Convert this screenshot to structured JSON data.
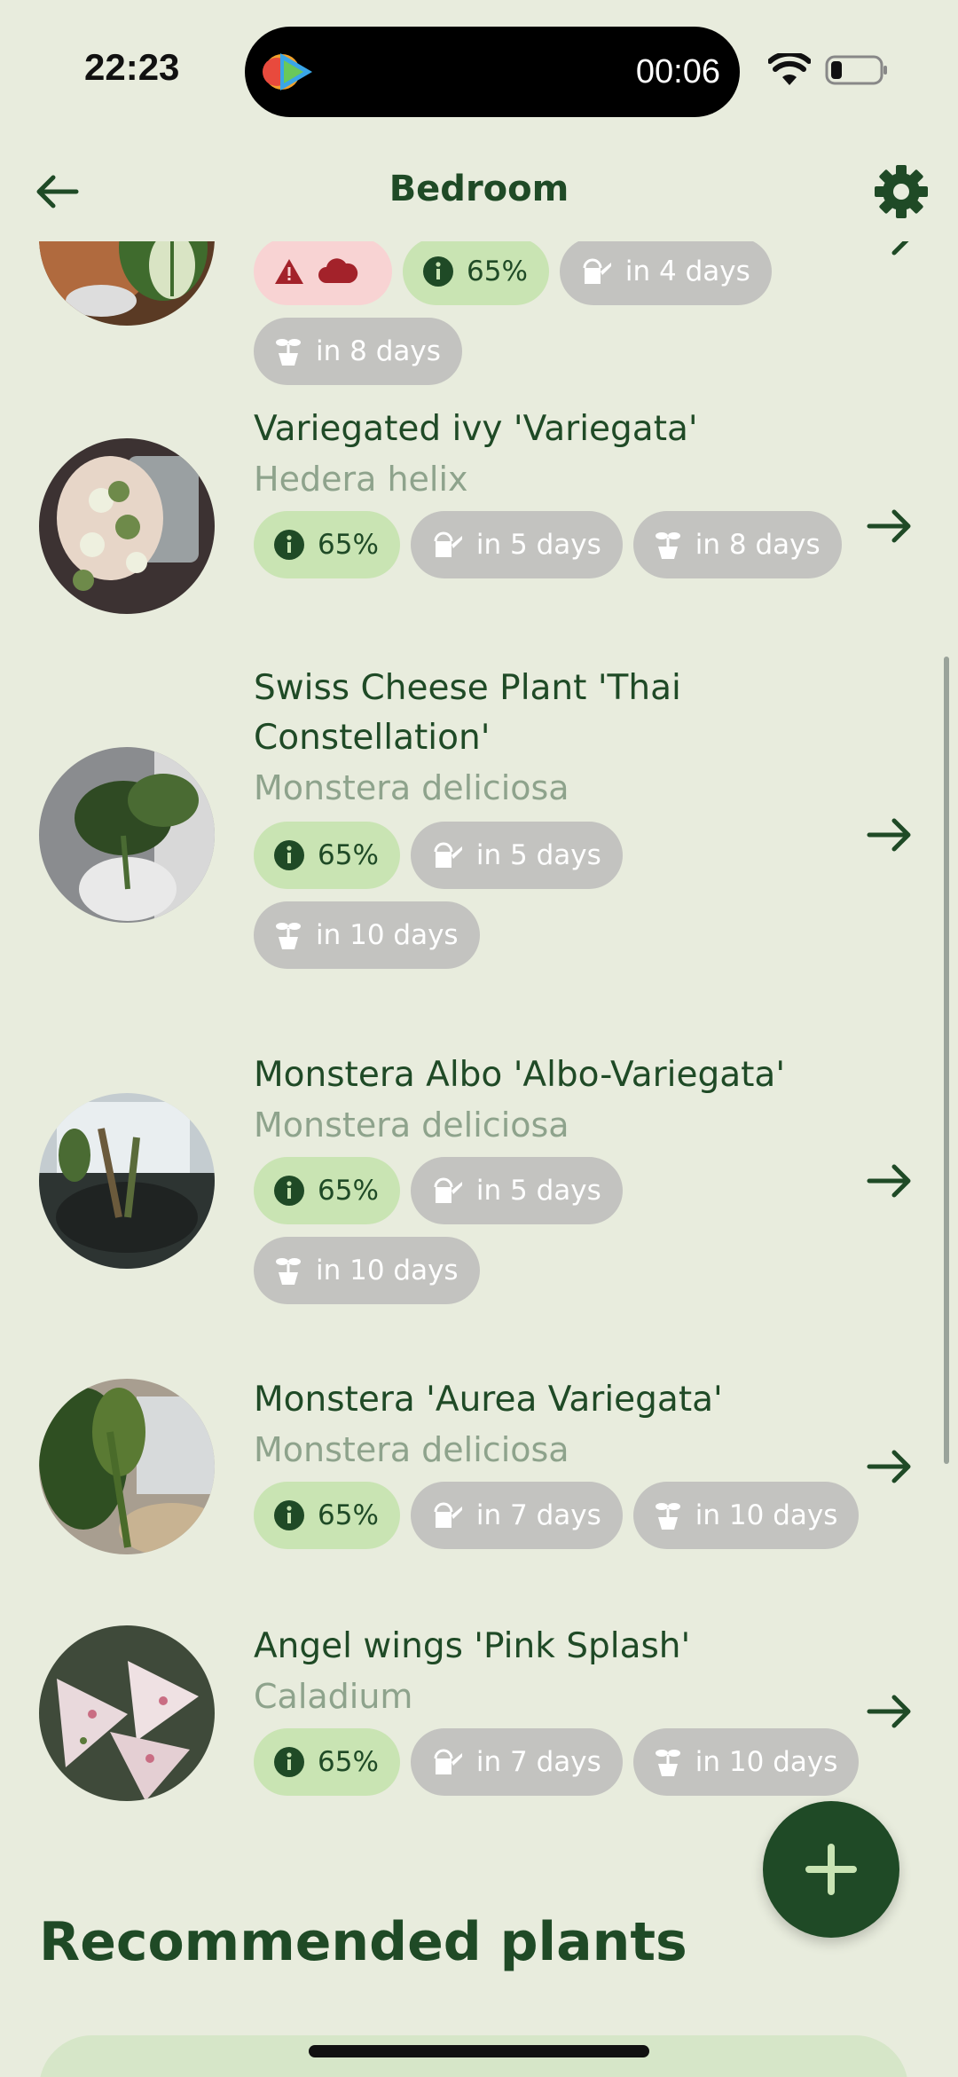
{
  "status_bar": {
    "time": "22:23",
    "recording_timer": "00:06"
  },
  "header": {
    "title": "Bedroom"
  },
  "plants": [
    {
      "name": "",
      "species": "",
      "chips": [
        {
          "type": "alert",
          "text": ""
        },
        {
          "type": "info",
          "text": "65%"
        },
        {
          "type": "water",
          "text": "in 4 days"
        },
        {
          "type": "fertilize",
          "text": "in 8 days"
        }
      ]
    },
    {
      "name": "Variegated ivy 'Variegata'",
      "species": "Hedera helix",
      "chips": [
        {
          "type": "info",
          "text": "65%"
        },
        {
          "type": "water",
          "text": "in 5 days"
        },
        {
          "type": "fertilize",
          "text": "in 8 days"
        }
      ]
    },
    {
      "name": "Swiss Cheese Plant 'Thai Constellation'",
      "species": "Monstera deliciosa",
      "chips": [
        {
          "type": "info",
          "text": "65%"
        },
        {
          "type": "water",
          "text": "in 5 days"
        },
        {
          "type": "fertilize",
          "text": "in 10 days"
        }
      ]
    },
    {
      "name": "Monstera Albo 'Albo-Variegata'",
      "species": "Monstera deliciosa",
      "chips": [
        {
          "type": "info",
          "text": "65%"
        },
        {
          "type": "water",
          "text": "in 5 days"
        },
        {
          "type": "fertilize",
          "text": "in 10 days"
        }
      ]
    },
    {
      "name": "Monstera 'Aurea Variegata'",
      "species": "Monstera deliciosa",
      "chips": [
        {
          "type": "info",
          "text": "65%"
        },
        {
          "type": "water",
          "text": "in 7 days"
        },
        {
          "type": "fertilize",
          "text": "in 10 days"
        }
      ]
    },
    {
      "name": "Angel wings 'Pink Splash'",
      "species": "Caladium",
      "chips": [
        {
          "type": "info",
          "text": "65%"
        },
        {
          "type": "water",
          "text": "in 7 days"
        },
        {
          "type": "fertilize",
          "text": "in 10 days"
        }
      ]
    }
  ],
  "recommended": {
    "title": "Recommended plants"
  },
  "colors": {
    "background": "#e8ecdd",
    "primary": "#1f4a26",
    "chip_grey": "#c3c3c0",
    "chip_green": "#c9e4b3",
    "chip_alert": "#f8d3d3",
    "alert_red": "#a3222a",
    "species_text": "#8ea38c"
  },
  "icons": {
    "back": "arrow-left-icon",
    "settings": "gear-icon",
    "row_action": "arrow-right-icon",
    "info": "info-icon",
    "water": "watering-can-icon",
    "fertilize": "fertilizer-icon",
    "alert": "warning-icon",
    "cloud": "cloud-icon",
    "add": "plus-icon"
  }
}
